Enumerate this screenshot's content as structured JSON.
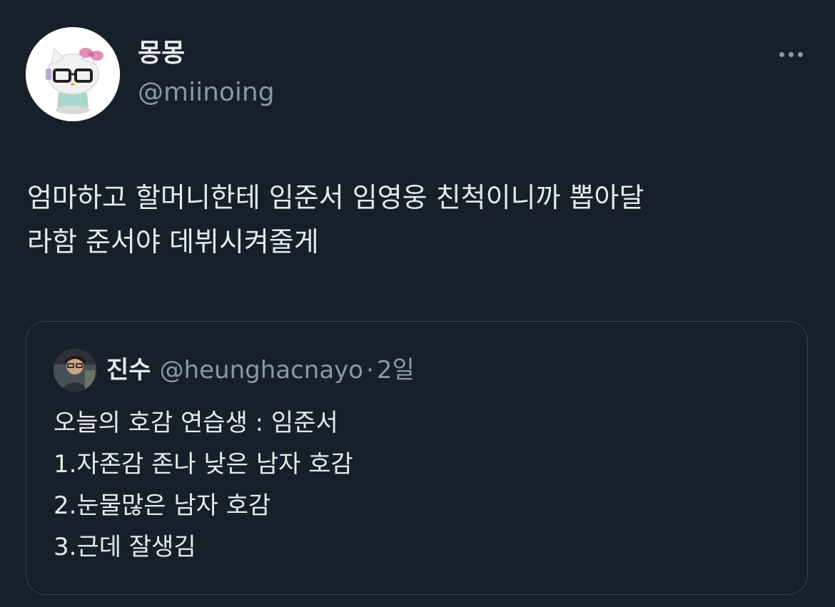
{
  "author": {
    "display_name": "몽몽",
    "handle": "@miinoing",
    "avatar_icon": "hello-kitty-glasses-avatar"
  },
  "more_icon": "more-dots-icon",
  "tweet": {
    "lines": [
      "엄마하고 할머니한테 임준서 임영웅 친척이니까 뽑아달",
      "라함 준서야 데뷔시켜줄게"
    ]
  },
  "quoted_tweet": {
    "display_name": "진수",
    "handle": "@heunghacnayo",
    "separator": "·",
    "time": "2일",
    "avatar_icon": "person-photo-avatar",
    "lines": [
      "오늘의 호감 연습생 : 임준서",
      "1.자존감 존나 낮은 남자 호감",
      "2.눈물많은 남자 호감",
      "3.근데 잘생김"
    ]
  },
  "colors": {
    "background": "#15202b",
    "primary_text": "#e7e9ea",
    "secondary_text": "#8b98a5",
    "border": "#38444d"
  }
}
